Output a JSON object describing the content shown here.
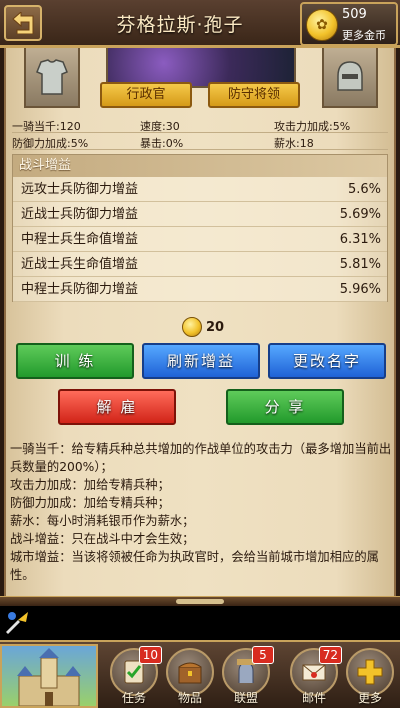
{
  "header": {
    "title": "芬格拉斯·孢子",
    "gold_amount": "509",
    "more_gold_label": "更多金币"
  },
  "roles": {
    "admin_button": "行政官",
    "guard_button": "防守将领"
  },
  "stats": [
    {
      "label": "一骑当千:120",
      "col": 0
    },
    {
      "label": "速度:30",
      "col": 1
    },
    {
      "label": "攻击力加成:5%",
      "col": 2
    },
    {
      "label": "防御力加成:5%",
      "col": 0
    },
    {
      "label": "暴击:0%",
      "col": 1
    },
    {
      "label": "薪水:18",
      "col": 2
    }
  ],
  "battle_bonus": {
    "header": "战斗增益",
    "rows": [
      {
        "label": "远攻士兵防御力增益",
        "value": "5.6%"
      },
      {
        "label": "近战士兵防御力增益",
        "value": "5.69%"
      },
      {
        "label": "中程士兵生命值增益",
        "value": "6.31%"
      },
      {
        "label": "近战士兵生命值增益",
        "value": "5.81%"
      },
      {
        "label": "中程士兵防御力增益",
        "value": "5.96%"
      }
    ]
  },
  "cost": "20",
  "buttons": {
    "train": "训 练",
    "refresh": "刷新增益",
    "rename": "更改名字",
    "dismiss": "解 雇",
    "share": "分 享"
  },
  "description": [
    "一骑当千：给专精兵种总共增加的作战单位的攻击力（最多增加当前出兵数量的200%）；",
    "攻击力加成：加给专精兵种；",
    "防御力加成：加给专精兵种；",
    "薪水：每小时消耗银币作为薪水；",
    "战斗增益：只在战斗中才会生效；",
    "城市增益：当该将领被任命为执政官时，会给当前城市增加相应的属性。"
  ],
  "nav": [
    {
      "label": "任务",
      "badge": "10",
      "icon": "quest-icon"
    },
    {
      "label": "物品",
      "badge": "",
      "icon": "chest-icon"
    },
    {
      "label": "联盟",
      "badge": "5",
      "icon": "alliance-icon"
    },
    {
      "label": "邮件",
      "badge": "72",
      "icon": "mail-icon"
    },
    {
      "label": "更多",
      "badge": "",
      "icon": "more-icon"
    }
  ],
  "colors": {
    "parchment": "#efe1c2",
    "gold_trim": "#c9a35b",
    "button_green": "#229a2c",
    "button_blue": "#1f62d6",
    "button_red": "#d12418",
    "badge_red": "#d82c20"
  }
}
